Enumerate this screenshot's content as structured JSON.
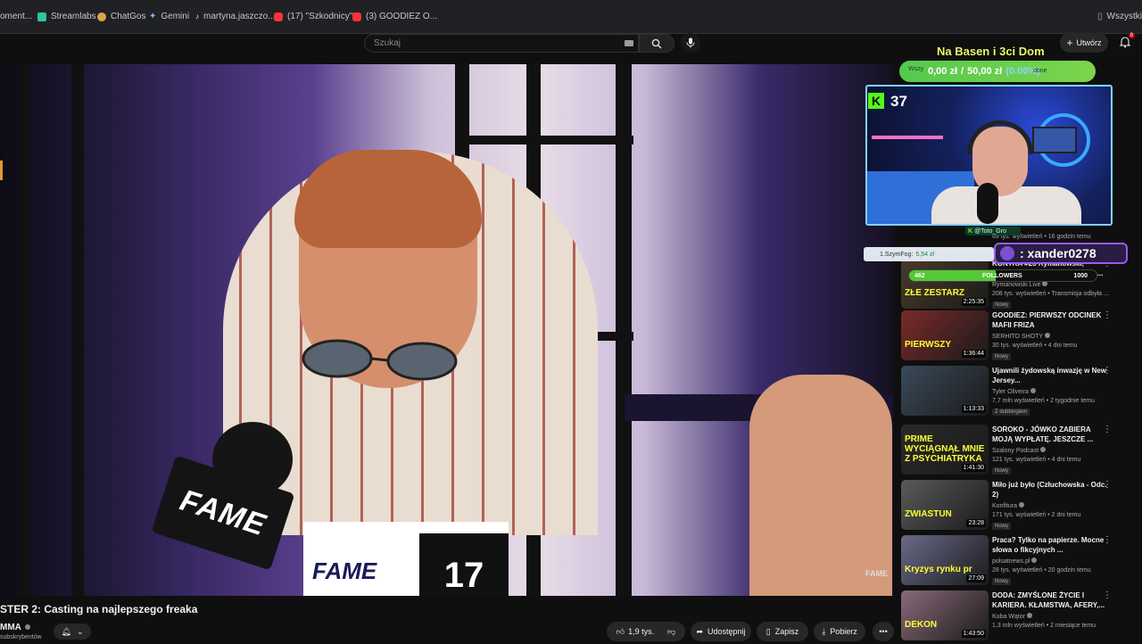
{
  "bookmarks": [
    {
      "label": "oment...",
      "color": "#5a5a5a"
    },
    {
      "label": "Streamlabs",
      "color": "#31c3a2"
    },
    {
      "label": "ChatGos",
      "color": "#e0a548"
    },
    {
      "label": "Gemini",
      "color": "#8ab4f8"
    },
    {
      "label": "martyna.jaszczo...",
      "color": "#222222"
    },
    {
      "label": "(17) \"Szkodnicy\"...",
      "color": "#ff3333"
    },
    {
      "label": "(3) GOODIEZ O...",
      "color": "#ff3333"
    }
  ],
  "bookmarks_all": "Wszystkie",
  "search": {
    "placeholder": "Szukaj"
  },
  "header": {
    "create_label": "Utwórz",
    "notif_count": "9"
  },
  "video": {
    "title": "STER 2: Casting na najlepszego freaka",
    "channel": "MMA",
    "subs": "subskrybentów",
    "flag_text": "FAME",
    "bib_text": "FAME",
    "bib_number": "17",
    "watermark": "FAME"
  },
  "actions": {
    "likes": "1,9 tys.",
    "share": "Udostępnij",
    "save": "Zapisz",
    "download": "Pobierz",
    "more": "•••"
  },
  "overlay": {
    "goal_title": "Na Basen i 3ci Dom",
    "goal_current": "0,00 zł",
    "goal_sep": "/",
    "goal_target": "50,00 zł",
    "goal_percent": "(0.00%)",
    "goal_ghost_left": "Wszy",
    "goal_ghost_right": "obne",
    "viewers": "37",
    "kick_letter": "K",
    "handle_k": "K",
    "handle": "@Toto_Gro",
    "donor_name": "1.SzymFog:",
    "donor_amount": "5,54 zł",
    "new_follower": ": xander0278",
    "followers_current": "462",
    "followers_label": "FOLLOWERS",
    "followers_goal": "1000",
    "followers_fill_fraction": 0.462
  },
  "recommendations": [
    {
      "title": "KONTRA #25 Rymanowski, Mazurkiewicz, Bartosiak: Gra o...",
      "channel": "Rymanowski Live",
      "meta": "208 tys. wyświetleń • Transmisja odbyła ...",
      "duration": "2:25:35",
      "badge": "Nowy",
      "thumb_text": "ZŁE ZESTARZ",
      "top_meta": "69 tys. wyświetleń • 16 godzin temu",
      "thumb_bg": "#4a3a2a"
    },
    {
      "title": "GOODIEZ: PIERWSZY ODCINEK MAFII FRIZA",
      "channel": "SERHITO SHOTY",
      "meta": "30 tys. wyświetleń • 4 dni temu",
      "duration": "1:36:44",
      "badge": "Nowy",
      "thumb_text": "PIERWSZY",
      "thumb_bg": "#7a2a2a"
    },
    {
      "title": "Ujawnili żydowską inwazję w New Jersey...",
      "channel": "Tyler Oliveira",
      "meta": "7,7 mln wyświetleń • 2 tygodnie temu",
      "duration": "1:13:33",
      "badge": "Z dubbingiem",
      "thumb_text": "",
      "thumb_bg": "#3a4a5a"
    },
    {
      "title": "SOROKO - JÓWKO ZABIERA MOJĄ WYPŁATĘ. JESZCZE ...",
      "channel": "Szalony Podcast",
      "meta": "121 tys. wyświetleń • 4 dni temu",
      "duration": "1:41:30",
      "badge": "Nowy",
      "thumb_text": "PRIME WYCIĄGNĄŁ MNIE Z PSYCHIATRYKA",
      "thumb_bg": "#2a2a2a"
    },
    {
      "title": "Miło już było (Człuchowska - Odc. 2)",
      "channel": "Konfitura",
      "meta": "171 tys. wyświetleń • 2 dni temu",
      "duration": "23:28",
      "badge": "Nowy",
      "thumb_text": "ZWIASTUN",
      "thumb_bg": "#5a5a5a"
    },
    {
      "title": "Praca? Tylko na papierze. Mocne słowa o fikcyjnych ...",
      "channel": "polsatnews.pl",
      "meta": "28 tys. wyświetleń • 20 godzin temu",
      "duration": "27:09",
      "badge": "Nowy",
      "thumb_text": "Kryzys rynku pr",
      "thumb_bg": "#6a6a8a"
    },
    {
      "title": "DODA: ZMYŚLONE ŻYCIE I KARIERA. KŁAMSTWA, AFERY,...",
      "channel": "Kuba Wątor",
      "meta": "1,3 mln wyświetleń • 2 miesiące temu",
      "duration": "1:43:50",
      "badge": "",
      "thumb_text": "DEKON",
      "thumb_bg": "#8a6a7a"
    }
  ],
  "colors": {
    "accent": "#53fc18",
    "bg": "#0f0f0f",
    "goal_green": "#54c94d",
    "follower_purple": "#9b59f5"
  }
}
